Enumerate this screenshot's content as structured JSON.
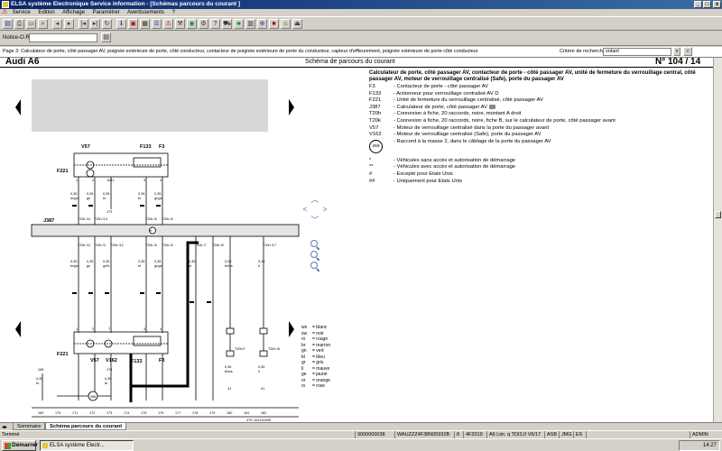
{
  "window": {
    "title": "ELSA système Electronique Service information - [Schémas parcours du courant ]",
    "controls": [
      "_",
      "□",
      "x"
    ]
  },
  "menu": {
    "items": [
      "Service",
      "Edition",
      "Affichage",
      "Paramétrer",
      "Avertissements",
      "?"
    ]
  },
  "toolbar": {
    "icons": [
      "save-icon",
      "print-icon",
      "open-icon",
      "search-icon",
      "back-icon",
      "forward-icon",
      "previous-icon",
      "next-icon",
      "refresh-icon",
      "info-icon",
      "document-icon",
      "image-icon",
      "list-icon",
      "warning-icon",
      "tools-icon",
      "globe-icon",
      "settings-icon",
      "help-icon",
      "car-icon",
      "tree-icon",
      "calculator-icon",
      "zoom-icon",
      "stop-icon",
      "home-icon",
      "exit-icon"
    ]
  },
  "order": {
    "label": "Notice-O.R.:",
    "value": ""
  },
  "pageline": {
    "text": "Page 3: Calculateur de porte, côté passager AV, poignée extérieure de porte, côté conducteur, contacteur de poignée extérieure de porte du conducteur, capteur d'effleurement, poignée extérieure de porte côté conducteur",
    "search_label": "Critère de recherche",
    "search_value": "volant"
  },
  "document": {
    "brand": "Audi A6",
    "title": "Schéma de parcours du courant",
    "page": "N° 104 / 14",
    "legend_heading": "Calculateur de porte, côté passager AV, contacteur de porte - côté passager AV, unité de fermeture du verrouillage central, côté passager AV, moteur de verrouillage centralisé (Safe), porte du passager AV",
    "legend": [
      {
        "code": "F3",
        "desc": "- Contacteur de porte - côté passager AV"
      },
      {
        "code": "F133",
        "desc": "- Actionneur pour verrouillage centralisé AV D"
      },
      {
        "code": "F221",
        "desc": "- Unité de fermeture du verrouillage centralisé, côté passager AV"
      },
      {
        "code": "J387",
        "desc": "- Calculateur de porte, côté passager AV"
      },
      {
        "code": "T20h",
        "desc": "- Connexion à fiche, 20 raccords, noire, montant A droit"
      },
      {
        "code": "T20k",
        "desc": "- Connexion à fiche, 20 raccords, noire, fiche B, sur le calculateur de porte, côté passager avant"
      },
      {
        "code": "V57",
        "desc": "- Moteur de verrouillage centralisé dans la porte du passager avant"
      },
      {
        "code": "V162",
        "desc": "- Moteur de verrouillage centralisé (Safe), porte du passager AV"
      },
      {
        "code": "268",
        "desc": "- Raccord à la masse 2, dans le câblage de la porte du passager AV"
      }
    ],
    "notes": [
      {
        "code": "*",
        "desc": "- Véhicules sans accès et autorisation de démarrage"
      },
      {
        "code": "**",
        "desc": "- Véhicules avec accès et autorisation de démarrage"
      },
      {
        "code": "#",
        "desc": "- Excepté pour Etats Unis"
      },
      {
        "code": "##",
        "desc": "- Uniquement pour Etats Unis"
      }
    ],
    "colors": [
      {
        "code": "ws",
        "name": "= blanc"
      },
      {
        "code": "sw",
        "name": "= noir"
      },
      {
        "code": "ro",
        "name": "= rouge"
      },
      {
        "code": "br",
        "name": "= marron"
      },
      {
        "code": "gn",
        "name": "= vert"
      },
      {
        "code": "bl",
        "name": "= bleu"
      },
      {
        "code": "gr",
        "name": "= gris"
      },
      {
        "code": "li",
        "name": "= mauve"
      },
      {
        "code": "ge",
        "name": "= jaune"
      },
      {
        "code": "or",
        "name": "= orange"
      },
      {
        "code": "rs",
        "name": "= rose"
      }
    ],
    "diagram": {
      "top_components": [
        "V57",
        "F133",
        "F3"
      ],
      "left_components": [
        "F221",
        "J387"
      ],
      "bottom_components": [
        "F221",
        "V57",
        "V162",
        "F133",
        "F3"
      ],
      "ground_labels": [
        "268"
      ],
      "connector_ref": "T20k",
      "top_wires": [
        {
          "pin": "1",
          "size": "0,35",
          "color": "br/gn",
          "conn": "T20k /11"
        },
        {
          "pin": "2",
          "size": "0,35",
          "color": "gn",
          "conn": "T20h /13"
        },
        {
          "pin": "6/31",
          "size": "0,35",
          "color": "br",
          "conn": "173"
        },
        {
          "pin": "3",
          "size": "0,35",
          "color": "bl",
          "conn": "T20k /8"
        },
        {
          "pin": "4",
          "size": "0,35",
          "color": "gr/ge",
          "conn": "T20k /5"
        }
      ],
      "mid_wires": [
        {
          "conn": "T20k /11",
          "size": "0,35",
          "color": "br/gn"
        },
        {
          "conn": "T20k /3",
          "size": "0,35",
          "color": "gn"
        },
        {
          "conn": "T20k /12",
          "size": "0,35",
          "color": "gr/bl"
        },
        {
          "conn": "T20k /8",
          "size": "0,35",
          "color": "bl"
        },
        {
          "conn": "T20k /5",
          "size": "0,35",
          "color": "gr/ge"
        },
        {
          "conn": "T20k /7",
          "size": "0,35",
          "color": "br"
        },
        {
          "conn": "T20k /8",
          "size": "0,35",
          "color": "bl/ws"
        },
        {
          "conn": "T20h /17",
          "size": "0,35",
          "color": "li"
        }
      ],
      "right_sub": [
        {
          "conn": "T20h/7",
          "size": "0,35",
          "color": "bl/ws",
          "ref": "41"
        },
        {
          "conn": "T20h /8",
          "size": "0,35",
          "color": "li",
          "ref": "41"
        }
      ],
      "bottom_wires": [
        {
          "ref": "165",
          "size": "0,35",
          "color": "br"
        },
        {
          "ref": "173",
          "size": "0,35",
          "color": "br"
        }
      ],
      "bottom_pins": [
        "1",
        "2",
        "7",
        "3",
        "4"
      ],
      "grid_numbers": [
        "169",
        "170",
        "171",
        "172",
        "173",
        "174",
        "175",
        "176",
        "177",
        "178",
        "179",
        "180",
        "181",
        "182"
      ],
      "doc_ref": "47E-10414040E"
    }
  },
  "tabs": {
    "items": [
      "Sommaire",
      "Schéma parcours du courant"
    ],
    "active": 1
  },
  "status": {
    "left": "Terminé",
    "fields": [
      "9000000038",
      "WAUZZZ4F38N05932B",
      "8",
      "4F2019",
      "A6 Lim. q TDI3,0 V6/17",
      "ASB",
      "JMG",
      "ES"
    ],
    "right": "ADMIN"
  },
  "taskbar": {
    "start": "Démarrer",
    "item": "ELSA système Electr...",
    "time": "14:27"
  }
}
